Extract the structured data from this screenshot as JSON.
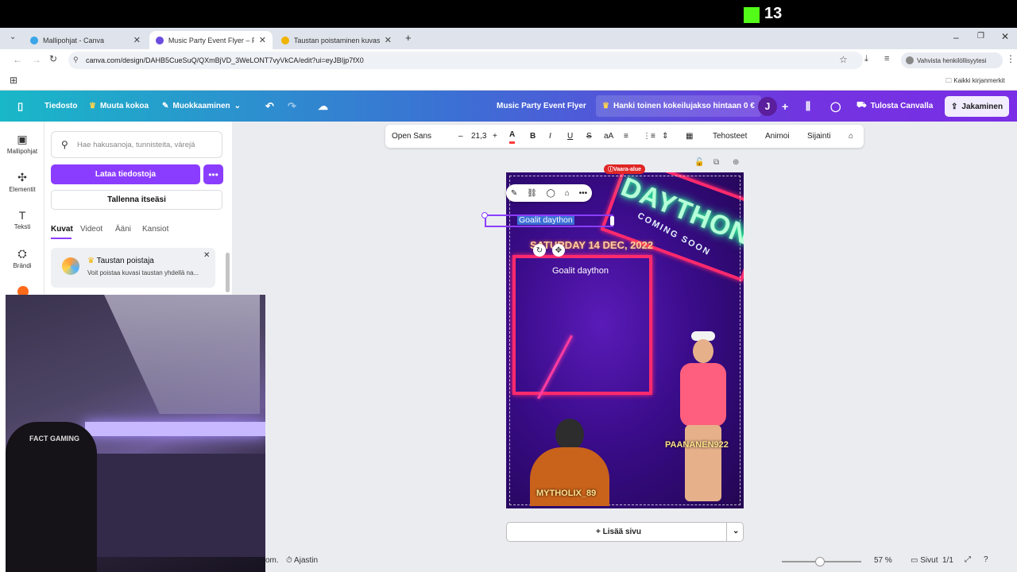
{
  "overlay": {
    "kick_count": "13"
  },
  "browser": {
    "tabs": [
      {
        "label": "Mallipohjat - Canva",
        "active": false
      },
      {
        "label": "Music Party Event Flyer – Flaije",
        "active": true
      },
      {
        "label": "Taustan poistaminen kuvasta: h",
        "active": false
      }
    ],
    "new_tab": "+",
    "url": "canva.com/design/DAHB5CueSuQ/QXmBjVD_3WeLONT7vyVkCA/edit?ui=eyJBIjp7fX0",
    "profile_label": "Vahvista henkilöllisyytesi",
    "bookmarks_label": "Kaikki kirjanmerkit"
  },
  "header": {
    "file": "Tiedosto",
    "resize": "Muuta kokoa",
    "editing": "Muokkaaminen",
    "title": "Music Party Event Flyer",
    "trial": "Hanki toinen kokeilujakso hintaan 0 €",
    "avatar": "J",
    "print": "Tulosta Canvalla",
    "share": "Jakaminen"
  },
  "rail": [
    {
      "label": "Mallipohjat",
      "icon": "templates-icon"
    },
    {
      "label": "Elementit",
      "icon": "elements-icon"
    },
    {
      "label": "Teksti",
      "icon": "text-icon"
    },
    {
      "label": "Brändi",
      "icon": "brand-icon"
    }
  ],
  "panel": {
    "search_placeholder": "Hae hakusanoja, tunnisteita, värejä",
    "upload": "Lataa tiedostoja",
    "record": "Tallenna itseäsi",
    "tabs": [
      "Kuvat",
      "Videot",
      "Ääni",
      "Kansiot"
    ],
    "bg_remover_title": "Taustan poistaja",
    "bg_remover_desc": "Voit poistaa kuvasi taustan yhdellä na..."
  },
  "toolbar": {
    "font": "Open Sans",
    "size": "21,3",
    "effects": "Tehosteet",
    "animate": "Animoi",
    "position": "Sijainti"
  },
  "design": {
    "danger_badge": "Vaara-alue",
    "selected_text": "Goalit daython",
    "headline": "DAYTHON",
    "subline": "COMING SOON",
    "date": "SATURDAY 14 DEC, 2022",
    "box_text": "Goalit daython",
    "player1": "MYTHOLIX_89",
    "player2": "PAANANEN922"
  },
  "add_page": "+ Lisää sivu",
  "footer": {
    "left_fragment": "om.",
    "timer": "Ajastin",
    "zoom": "57 %",
    "pages_label": "Sivut",
    "page_count": "1/1"
  },
  "webcam": {
    "chair_text": "FACT GAMING"
  }
}
